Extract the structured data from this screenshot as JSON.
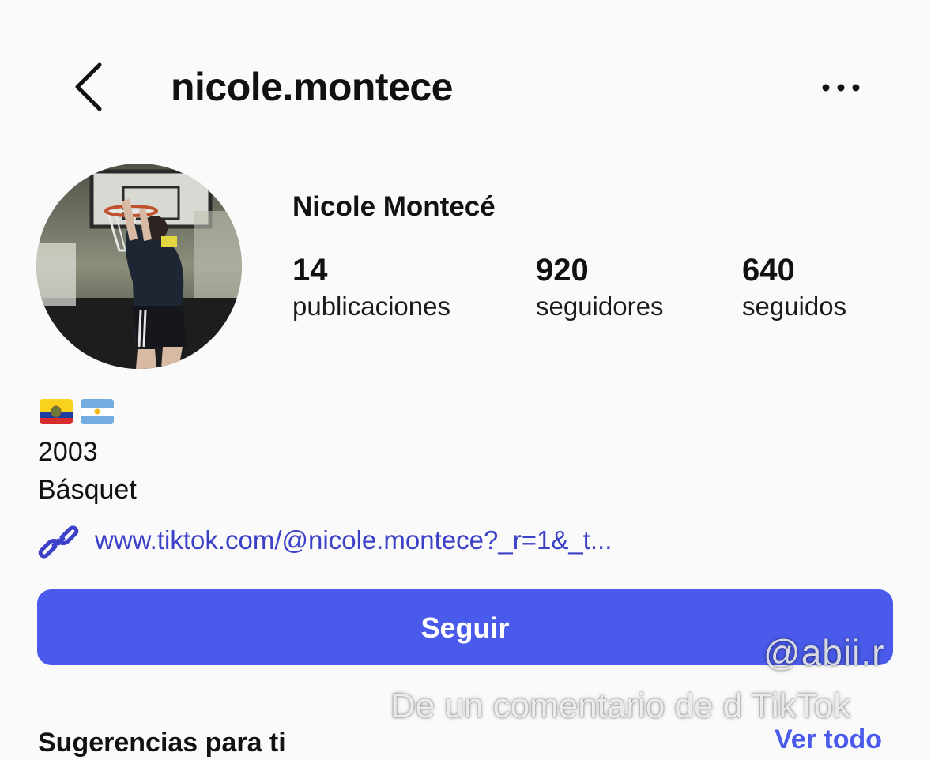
{
  "header": {
    "username": "nicole.montece",
    "back_icon": "chevron-left-icon",
    "more_icon": "more-horizontal-icon"
  },
  "profile": {
    "avatar_icon": "profile-photo",
    "display_name": "Nicole Montecé",
    "stats": [
      {
        "value": "14",
        "label": "publicaciones"
      },
      {
        "value": "920",
        "label": "seguidores"
      },
      {
        "value": "640",
        "label": "seguidos"
      }
    ]
  },
  "bio": {
    "flags": [
      "Ecuador flag",
      "Argentina flag"
    ],
    "lines": [
      "2003",
      "Básquet"
    ],
    "link_icon": "link-icon",
    "link_text": "www.tiktok.com/@nicole.montece?_r=1&_t..."
  },
  "actions": {
    "follow_label": "Seguir",
    "follow_color": "#4a5bec"
  },
  "watermark": {
    "handle": "@abii.r",
    "caption": "De un comentario de d TikTok"
  },
  "suggestions": {
    "title": "Sugerencias para ti",
    "see_all": "Ver todo"
  }
}
